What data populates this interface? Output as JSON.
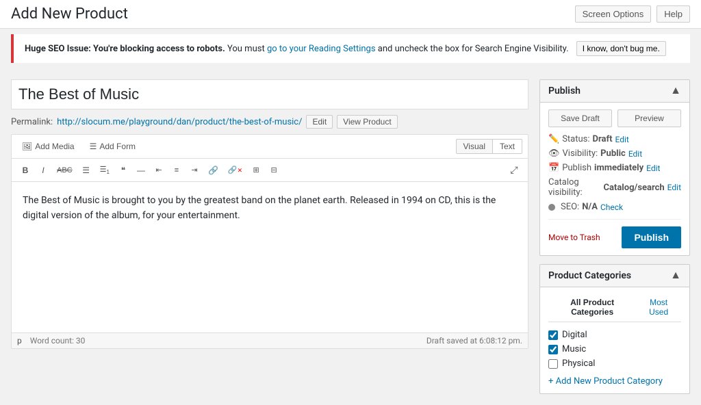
{
  "header": {
    "title": "Add New Product",
    "screen_options_label": "Screen Options",
    "help_label": "Help"
  },
  "seo_notice": {
    "text_bold": "Huge SEO Issue: You're blocking access to robots.",
    "text_normal": " You must ",
    "link_text": "go to your Reading Settings",
    "text_after": " and uncheck the box for Search Engine Visibility.",
    "dismiss_label": "I know, don't bug me."
  },
  "editor": {
    "product_title_placeholder": "The Best of Music",
    "permalink_label": "Permalink:",
    "permalink_url": "http://slocum.me/playground/dan/product/the-best-of-music/",
    "permalink_edit_label": "Edit",
    "permalink_view_label": "View Product",
    "add_media_label": "Add Media",
    "add_form_label": "Add Form",
    "visual_tab": "Visual",
    "text_tab": "Text",
    "content": "The Best of Music is brought to you by the greatest band on the planet earth. Released in 1994 on CD, this is the digital version of the album, for your entertainment.",
    "path_indicator": "p",
    "word_count_label": "Word count: 30",
    "draft_saved_label": "Draft saved at 6:08:12 pm.",
    "format_buttons": [
      {
        "label": "B",
        "title": "Bold"
      },
      {
        "label": "I",
        "title": "Italic"
      },
      {
        "label": "ABC",
        "title": "Strikethrough"
      },
      {
        "label": "≡",
        "title": "Unordered list"
      },
      {
        "label": "≡#",
        "title": "Ordered list"
      },
      {
        "label": "❝",
        "title": "Blockquote"
      },
      {
        "label": "—",
        "title": "Horizontal rule"
      },
      {
        "label": "≡l",
        "title": "Align left"
      },
      {
        "label": "≡c",
        "title": "Align center"
      },
      {
        "label": "≡r",
        "title": "Align right"
      },
      {
        "label": "🔗",
        "title": "Insert link"
      },
      {
        "label": "🔗✕",
        "title": "Remove link"
      },
      {
        "label": "⊞",
        "title": "Insert table"
      },
      {
        "label": "⊟",
        "title": "Table options"
      }
    ]
  },
  "publish_panel": {
    "title": "Publish",
    "save_draft_label": "Save Draft",
    "preview_label": "Preview",
    "status_label": "Status:",
    "status_value": "Draft",
    "status_edit": "Edit",
    "visibility_label": "Visibility:",
    "visibility_value": "Public",
    "visibility_edit": "Edit",
    "publish_label": "Publish",
    "publish_value": "immediately",
    "publish_edit": "Edit",
    "catalog_label": "Catalog visibility:",
    "catalog_value": "Catalog/search",
    "catalog_edit": "Edit",
    "seo_label": "SEO:",
    "seo_value": "N/A",
    "seo_check": "Check",
    "trash_label": "Move to Trash",
    "publish_btn": "Publish"
  },
  "categories_panel": {
    "title": "Product Categories",
    "tab_all": "All Product Categories",
    "tab_most_used": "Most Used",
    "categories": [
      {
        "label": "Digital",
        "checked": true
      },
      {
        "label": "Music",
        "checked": true
      },
      {
        "label": "Physical",
        "checked": false
      }
    ],
    "add_link": "+ Add New Product Category"
  }
}
